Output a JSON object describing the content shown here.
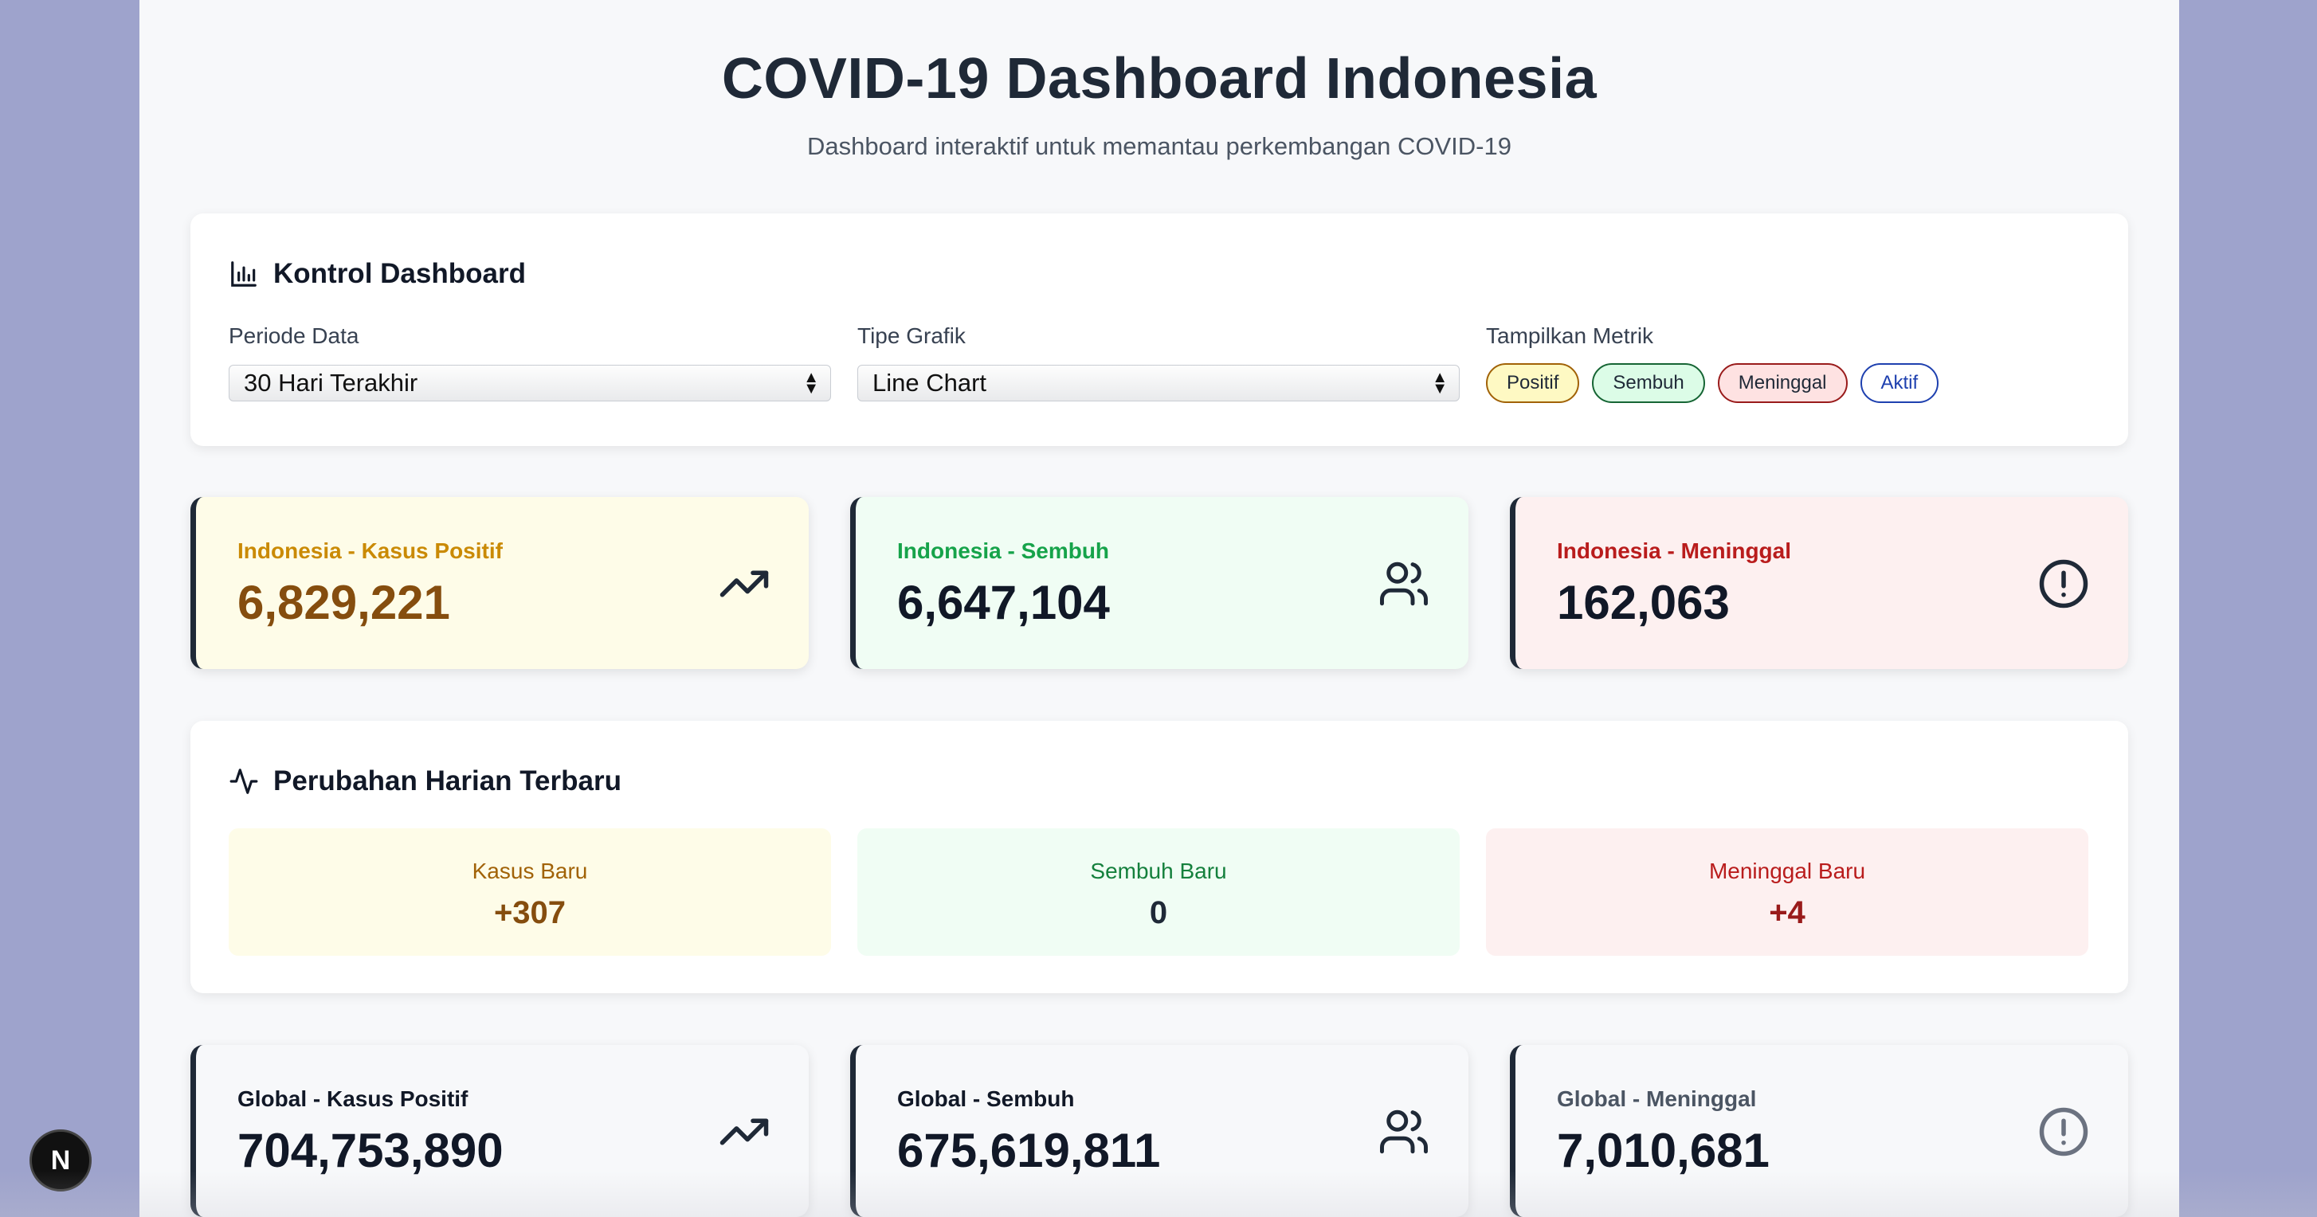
{
  "header": {
    "title": "COVID-19 Dashboard Indonesia",
    "subtitle": "Dashboard interaktif untuk memantau perkembangan COVID-19"
  },
  "controls": {
    "title": "Kontrol Dashboard",
    "period_label": "Periode Data",
    "period_value": "30 Hari Terakhir",
    "chart_type_label": "Tipe Grafik",
    "chart_type_value": "Line Chart",
    "metrics_label": "Tampilkan Metrik",
    "metrics": [
      {
        "label": "Positif",
        "bg": "#fef9c3",
        "border": "#a16207"
      },
      {
        "label": "Sembuh",
        "bg": "#dcfce7",
        "border": "#166534"
      },
      {
        "label": "Meninggal",
        "bg": "#fee2e2",
        "border": "#991b1b"
      },
      {
        "label": "Aktif",
        "bg": "#ffffff",
        "border": "#1e40af",
        "text": "#1e40af"
      }
    ]
  },
  "indonesia": [
    {
      "label": "Indonesia - Kasus Positif",
      "value": "6,829,221",
      "icon": "trending-up-icon"
    },
    {
      "label": "Indonesia - Sembuh",
      "value": "6,647,104",
      "icon": "users-icon"
    },
    {
      "label": "Indonesia - Meninggal",
      "value": "162,063",
      "icon": "alert-circle-icon"
    }
  ],
  "daily": {
    "title": "Perubahan Harian Terbaru",
    "items": [
      {
        "label": "Kasus Baru",
        "value": "+307"
      },
      {
        "label": "Sembuh Baru",
        "value": "0"
      },
      {
        "label": "Meninggal Baru",
        "value": "+4"
      }
    ]
  },
  "global": [
    {
      "label": "Global - Kasus Positif",
      "value": "704,753,890",
      "icon": "trending-up-icon"
    },
    {
      "label": "Global - Sembuh",
      "value": "675,619,811",
      "icon": "users-icon"
    },
    {
      "label": "Global - Meninggal",
      "value": "7,010,681",
      "icon": "alert-circle-icon"
    }
  ],
  "badge": {
    "letter": "N"
  },
  "colors": {
    "positive": "#b45309",
    "recovered": "#16a34a",
    "death": "#dc2626"
  }
}
